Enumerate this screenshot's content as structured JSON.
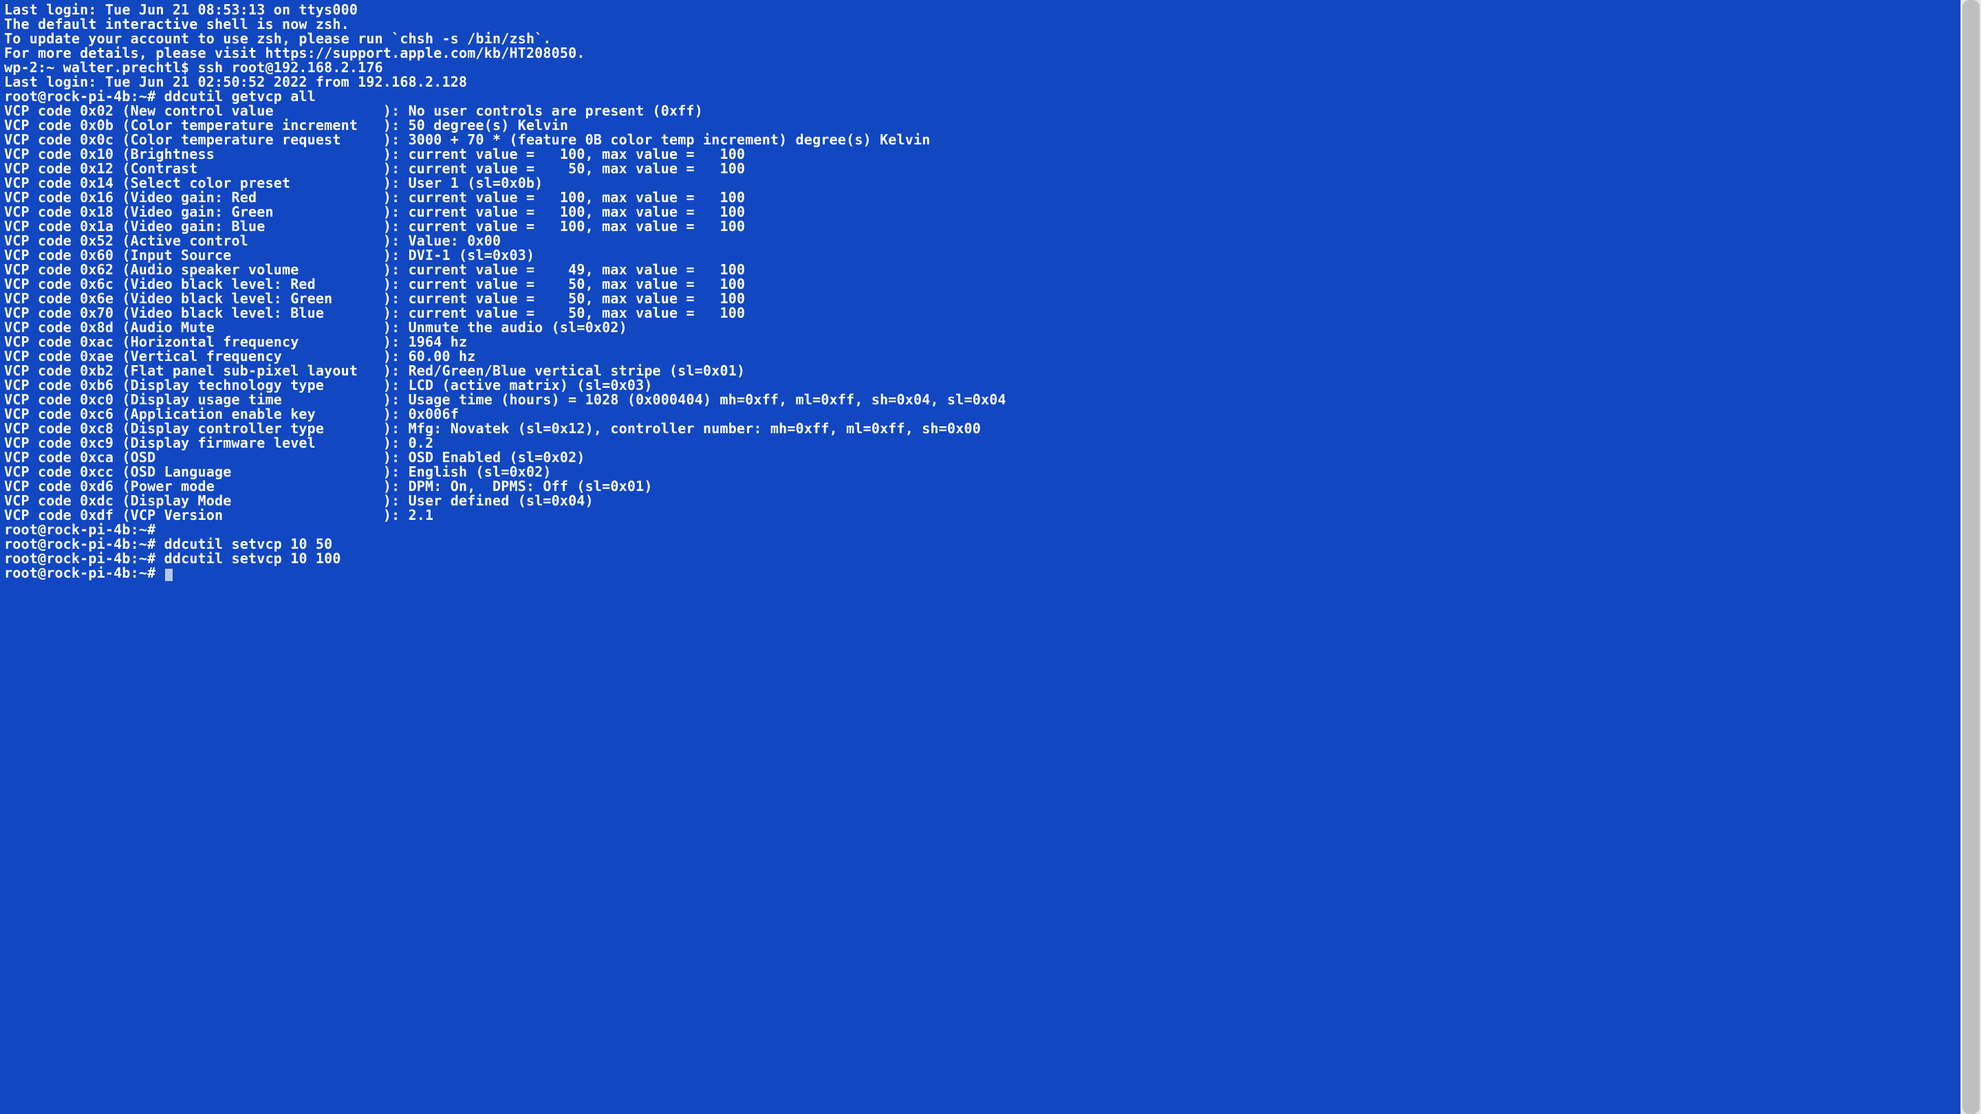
{
  "colors": {
    "background": "#1247c2",
    "text": "#ffffff",
    "cursor": "#b5c9ef"
  },
  "session": {
    "last_login_local": "Last login: Tue Jun 21 08:53:13 on ttys000",
    "blank1": "",
    "zsh_notice_1": "The default interactive shell is now zsh.",
    "zsh_notice_2": "To update your account to use zsh, please run `chsh -s /bin/zsh`.",
    "zsh_notice_3": "For more details, please visit https://support.apple.com/kb/HT208050.",
    "local_prompt_ssh": "wp-2:~ walter.prechtl$ ssh root@192.168.2.176",
    "remote_last_login": "Last login: Tue Jun 21 02:50:52 2022 from 192.168.2.128"
  },
  "commands": {
    "c1_prompt": "root@rock-pi-4b:~# ",
    "c1_cmd": "ddcutil getvcp all",
    "c2_prompt": "root@rock-pi-4b:~# ",
    "c2_cmd": "",
    "c3_prompt": "root@rock-pi-4b:~# ",
    "c3_cmd": "ddcutil setvcp 10 50",
    "c4_prompt": "root@rock-pi-4b:~# ",
    "c4_cmd": "ddcutil setvcp 10 100",
    "c5_prompt": "root@rock-pi-4b:~# ",
    "c5_cmd": ""
  },
  "vcp": {
    "l00": "VCP code 0x02 (New control value             ): No user controls are present (0xff)",
    "l01": "VCP code 0x0b (Color temperature increment   ): 50 degree(s) Kelvin",
    "l02": "VCP code 0x0c (Color temperature request     ): 3000 + 70 * (feature 0B color temp increment) degree(s) Kelvin",
    "l03": "VCP code 0x10 (Brightness                    ): current value =   100, max value =   100",
    "l04": "VCP code 0x12 (Contrast                      ): current value =    50, max value =   100",
    "l05": "VCP code 0x14 (Select color preset           ): User 1 (sl=0x0b)",
    "l06": "VCP code 0x16 (Video gain: Red               ): current value =   100, max value =   100",
    "l07": "VCP code 0x18 (Video gain: Green             ): current value =   100, max value =   100",
    "l08": "VCP code 0x1a (Video gain: Blue              ): current value =   100, max value =   100",
    "l09": "VCP code 0x52 (Active control                ): Value: 0x00",
    "l10": "VCP code 0x60 (Input Source                  ): DVI-1 (sl=0x03)",
    "l11": "VCP code 0x62 (Audio speaker volume          ): current value =    49, max value =   100",
    "l12": "VCP code 0x6c (Video black level: Red        ): current value =    50, max value =   100",
    "l13": "VCP code 0x6e (Video black level: Green      ): current value =    50, max value =   100",
    "l14": "VCP code 0x70 (Video black level: Blue       ): current value =    50, max value =   100",
    "l15": "VCP code 0x8d (Audio Mute                    ): Unmute the audio (sl=0x02)",
    "l16": "VCP code 0xac (Horizontal frequency          ): 1964 hz",
    "l17": "VCP code 0xae (Vertical frequency            ): 60.00 hz",
    "l18": "VCP code 0xb2 (Flat panel sub-pixel layout   ): Red/Green/Blue vertical stripe (sl=0x01)",
    "l19": "VCP code 0xb6 (Display technology type       ): LCD (active matrix) (sl=0x03)",
    "l20": "VCP code 0xc0 (Display usage time            ): Usage time (hours) = 1028 (0x000404) mh=0xff, ml=0xff, sh=0x04, sl=0x04",
    "l21": "VCP code 0xc6 (Application enable key        ): 0x006f",
    "l22": "VCP code 0xc8 (Display controller type       ): Mfg: Novatek (sl=0x12), controller number: mh=0xff, ml=0xff, sh=0x00",
    "l23": "VCP code 0xc9 (Display firmware level        ): 0.2",
    "l24": "VCP code 0xca (OSD                           ): OSD Enabled (sl=0x02)",
    "l25": "VCP code 0xcc (OSD Language                  ): English (sl=0x02)",
    "l26": "VCP code 0xd6 (Power mode                    ): DPM: On,  DPMS: Off (sl=0x01)",
    "l27": "VCP code 0xdc (Display Mode                  ): User defined (sl=0x04)",
    "l28": "VCP code 0xdf (VCP Version                   ): 2.1"
  }
}
